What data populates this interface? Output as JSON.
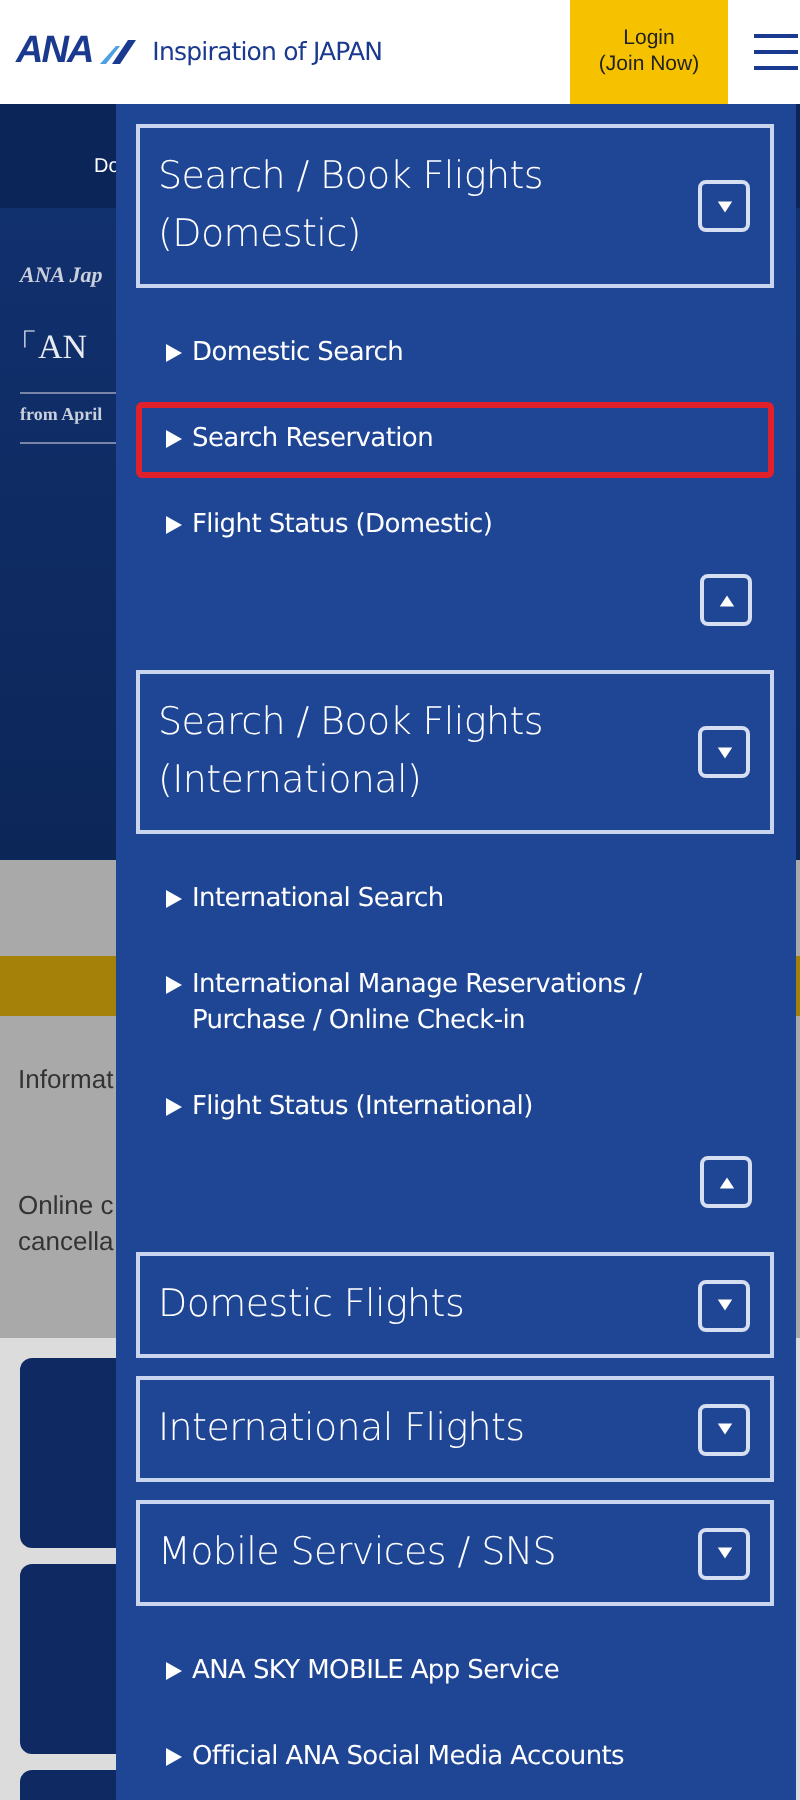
{
  "header": {
    "logo_mark": "ANA",
    "tagline": "Inspiration of JAPAN",
    "login_button": [
      "Login",
      "(Join Now)"
    ]
  },
  "background_page": {
    "nav_text": "Do",
    "hero_lines": [
      {
        "kind": "caption",
        "text": "ANA Jap"
      },
      {
        "kind": "headline",
        "text": "「AN"
      },
      {
        "kind": "date",
        "text": "from April"
      }
    ],
    "info_text": "Informat",
    "notice_lines": [
      "Online c",
      "cancella"
    ]
  },
  "menu": {
    "sections": [
      {
        "title": "Search / Book Flights (Domestic)",
        "show_collapse": true,
        "items": [
          {
            "label": "Domestic Search",
            "highlighted": false
          },
          {
            "label": "Search Reservation",
            "highlighted": true
          },
          {
            "label": "Flight Status (Domestic)",
            "highlighted": false
          }
        ]
      },
      {
        "title": "Search / Book Flights (International)",
        "show_collapse": true,
        "items": [
          {
            "label": "International Search",
            "highlighted": false
          },
          {
            "label": "International Manage Reservations / Purchase / Online Check-in",
            "highlighted": false
          },
          {
            "label": "Flight Status (International)",
            "highlighted": false
          }
        ]
      },
      {
        "title": "Domestic Flights"
      },
      {
        "title": "International Flights"
      },
      {
        "title": "Mobile Services / SNS",
        "items": [
          {
            "label": "ANA SKY MOBILE App Service",
            "highlighted": false
          },
          {
            "label": "Official ANA Social Media Accounts",
            "highlighted": false
          }
        ]
      }
    ]
  }
}
